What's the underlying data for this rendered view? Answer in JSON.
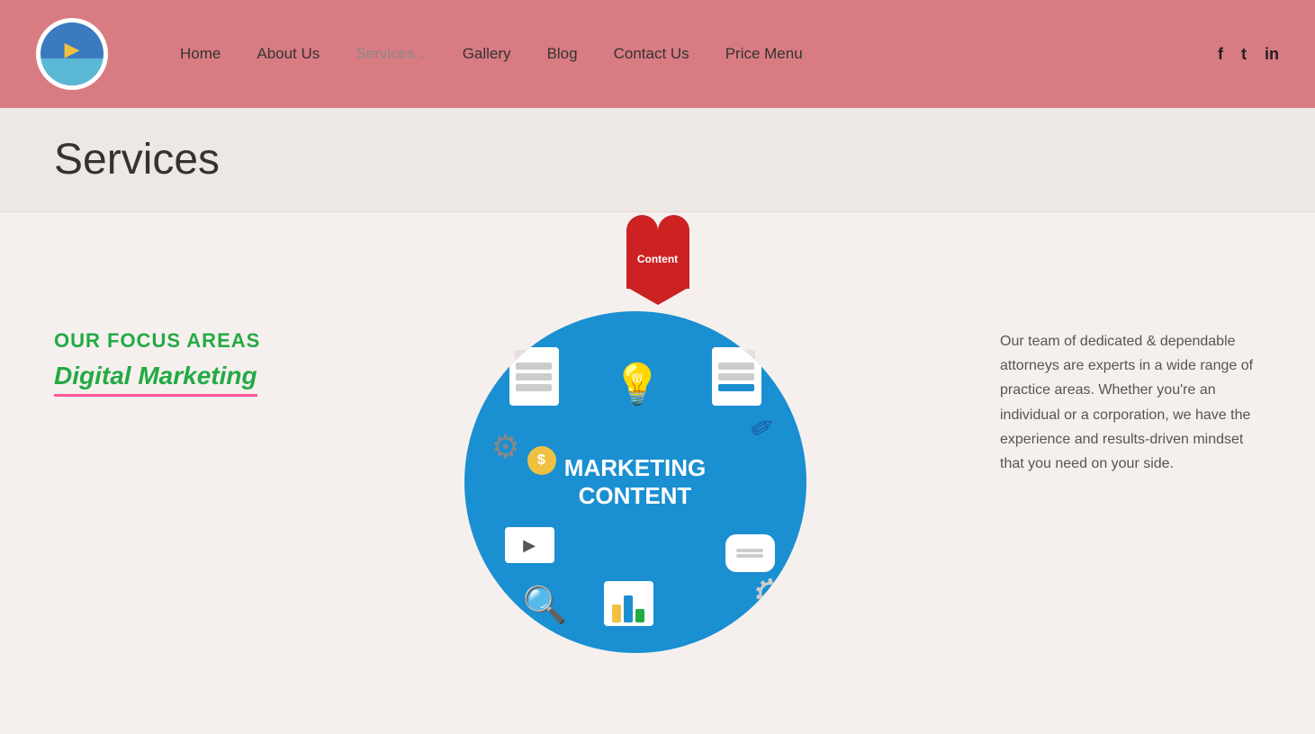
{
  "header": {
    "logo_alt": "Company Logo",
    "nav": {
      "home": "Home",
      "about_us": "About Us",
      "services": "Services",
      "gallery": "Gallery",
      "blog": "Blog",
      "contact_us": "Contact Us",
      "price_menu": "Price Menu"
    },
    "social": {
      "facebook": "f",
      "twitter": "t",
      "linkedin": "in"
    }
  },
  "page": {
    "title": "Services"
  },
  "heart_badge": {
    "label": "Content"
  },
  "focus": {
    "heading": "OUR FOCUS AREAS",
    "subheading": "Digital Marketing"
  },
  "marketing_circle": {
    "line1": "MARKETING",
    "line2": "CONTENT"
  },
  "right_text": {
    "paragraph": "Our team of dedicated & dependable attorneys are experts in a wide range of practice areas. Whether you're an individual or a corporation, we have the experience and results-driven mindset that you need on your side."
  }
}
